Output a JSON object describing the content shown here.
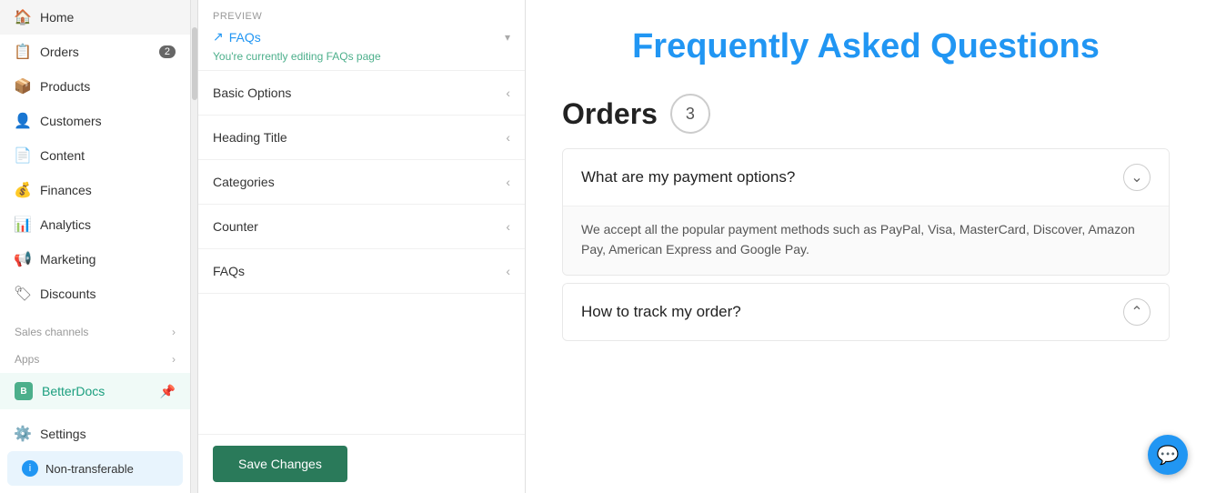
{
  "sidebar": {
    "items": [
      {
        "label": "Home",
        "icon": "🏠",
        "badge": null
      },
      {
        "label": "Orders",
        "icon": "📋",
        "badge": "2"
      },
      {
        "label": "Products",
        "icon": "📦",
        "badge": null
      },
      {
        "label": "Customers",
        "icon": "👤",
        "badge": null
      },
      {
        "label": "Content",
        "icon": "📄",
        "badge": null
      },
      {
        "label": "Finances",
        "icon": "💰",
        "badge": null
      },
      {
        "label": "Analytics",
        "icon": "📊",
        "badge": null
      },
      {
        "label": "Marketing",
        "icon": "📢",
        "badge": null
      },
      {
        "label": "Discounts",
        "icon": "🏷",
        "badge": null
      }
    ],
    "sales_channels_label": "Sales channels",
    "apps_label": "Apps",
    "active_app": "BetterDocs",
    "active_app_pin": "📌",
    "settings_label": "Settings",
    "non_transferable_label": "Non-transferable"
  },
  "middle": {
    "preview_label": "PREVIEW",
    "preview_link_text": "FAQs",
    "editing_note": "You're currently editing FAQs page",
    "accordion_items": [
      {
        "label": "Basic Options"
      },
      {
        "label": "Heading Title"
      },
      {
        "label": "Categories"
      },
      {
        "label": "Counter"
      },
      {
        "label": "FAQs"
      }
    ],
    "save_button_label": "Save Changes"
  },
  "preview": {
    "main_title": "Frequently Asked Questions",
    "section_title": "Orders",
    "section_count": "3",
    "faqs": [
      {
        "question": "What are my payment options?",
        "answer": "We accept all the popular payment methods such as PayPal, Visa, MasterCard, Discover, Amazon Pay, American Express and Google Pay.",
        "expanded": true
      },
      {
        "question": "How to track my order?",
        "answer": null,
        "expanded": false
      }
    ]
  },
  "app_header": {
    "title": "BetterDocs"
  }
}
